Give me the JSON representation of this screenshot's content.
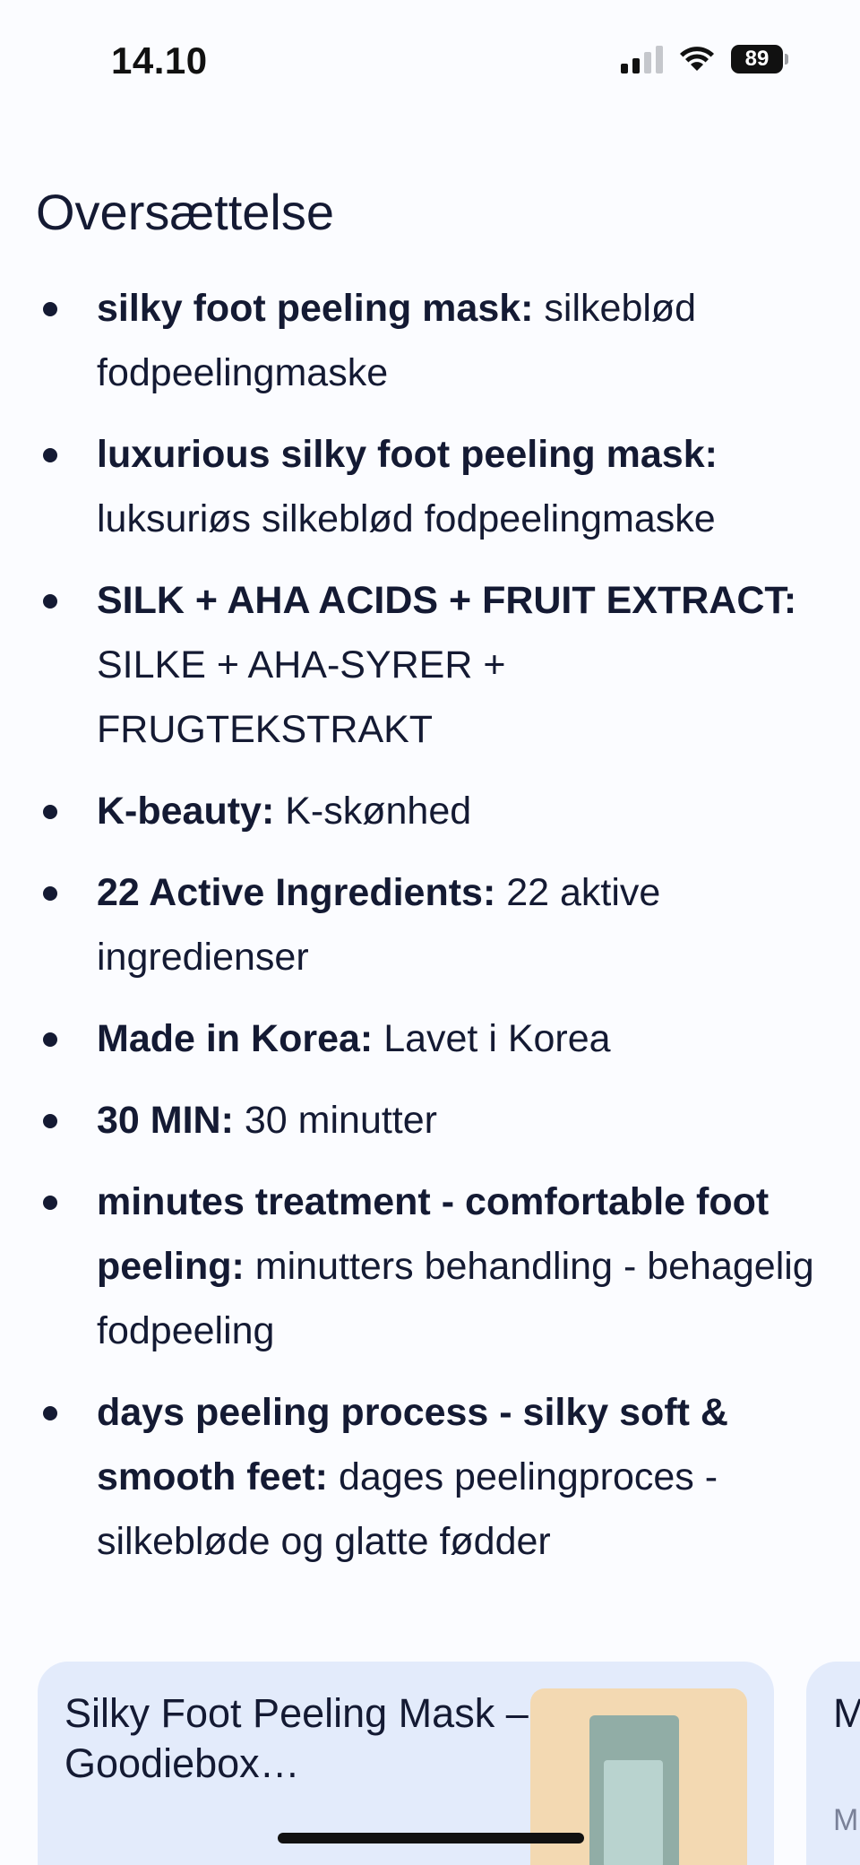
{
  "status_bar": {
    "time": "14.10",
    "battery_level": "89",
    "signal_bars_active": 2,
    "signal_bars_total": 4,
    "icons": [
      "cellular-signal-icon",
      "wifi-icon",
      "battery-icon"
    ]
  },
  "translation": {
    "title": "Oversættelse",
    "items": [
      {
        "term": "silky foot peeling mask:",
        "translation": "silkeblød fodpeelingmaske"
      },
      {
        "term": "luxurious silky foot peeling mask:",
        "translation": "luksuriøs silkeblød fodpeelingmaske"
      },
      {
        "term": "SILK + AHA ACIDS + FRUIT EXTRACT:",
        "translation": "SILKE + AHA-SYRER + FRUGTEKSTRAKT"
      },
      {
        "term": "K-beauty:",
        "translation": "K-skønhed"
      },
      {
        "term": "22 Active Ingredients:",
        "translation": "22 aktive ingredienser"
      },
      {
        "term": "Made in Korea:",
        "translation": "Lavet i Korea"
      },
      {
        "term": "30 MIN:",
        "translation": "30 minutter"
      },
      {
        "term": "minutes treatment - comfortable foot peeling:",
        "translation": "minutters behandling - behagelig fodpeeling"
      },
      {
        "term": "days peeling process - silky soft & smooth feet:",
        "translation": "dages peelingproces - silkebløde og glatte fødder"
      }
    ]
  },
  "result_cards": [
    {
      "title": "Silky Foot Peeling Mask – Goodiebox…"
    },
    {
      "title": "M P",
      "subtitle": "M M"
    }
  ],
  "colors": {
    "background": "#fbfcff",
    "text": "#141a33",
    "card_background": "#e3ebfb"
  }
}
